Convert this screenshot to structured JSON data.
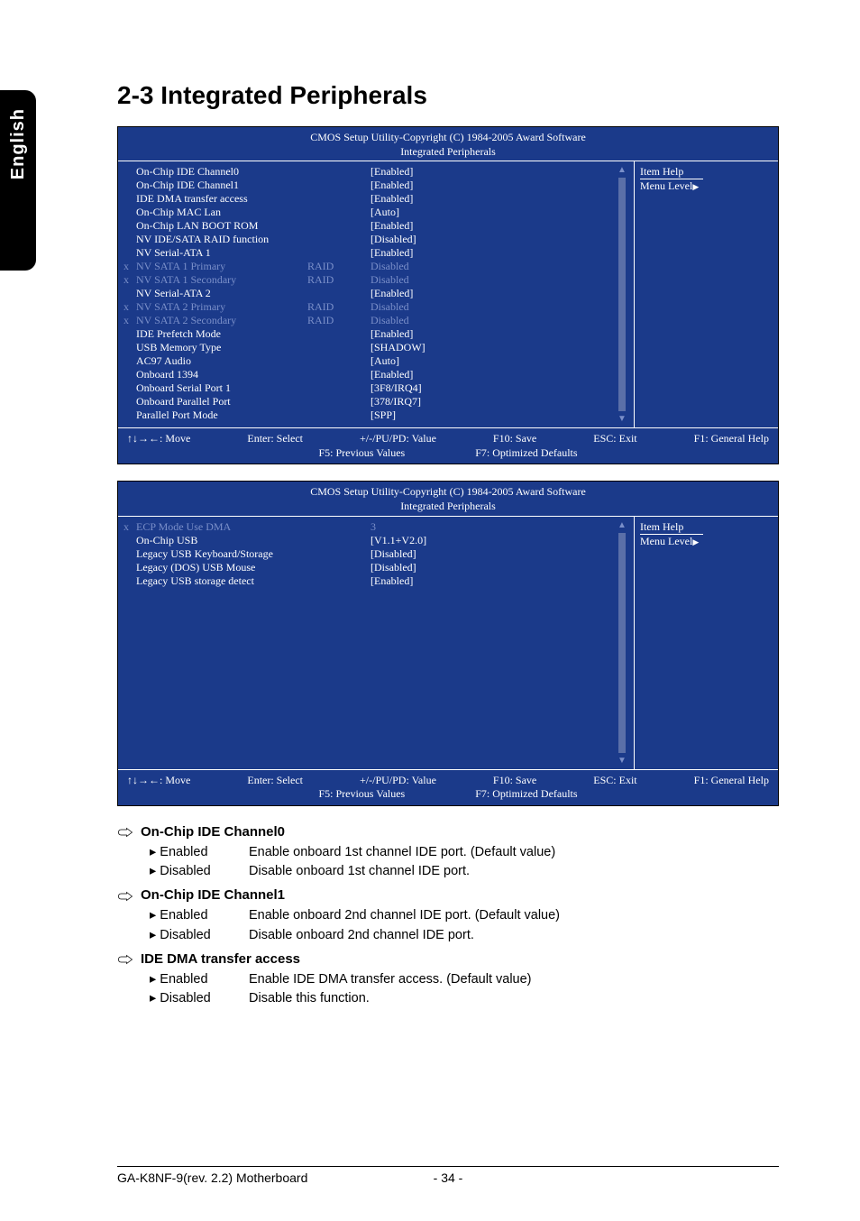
{
  "sideTab": "English",
  "title": "2-3    Integrated Peripherals",
  "biosHeader1": "CMOS Setup Utility-Copyright (C) 1984-2005 Award Software",
  "biosHeader2": "Integrated Peripherals",
  "helpTitle": "Item Help",
  "menuLevel": "Menu Level",
  "screen1": {
    "rows": [
      {
        "x": "",
        "label": "On-Chip IDE Channel0",
        "col3": "",
        "val": "[Enabled]",
        "dim": false
      },
      {
        "x": "",
        "label": "On-Chip IDE Channel1",
        "col3": "",
        "val": "[Enabled]",
        "dim": false
      },
      {
        "x": "",
        "label": "IDE DMA transfer access",
        "col3": "",
        "val": "[Enabled]",
        "dim": false
      },
      {
        "x": "",
        "label": "On-Chip MAC Lan",
        "col3": "",
        "val": "[Auto]",
        "dim": false
      },
      {
        "x": "",
        "label": "On-Chip LAN BOOT ROM",
        "col3": "",
        "val": "[Enabled]",
        "dim": false
      },
      {
        "x": "",
        "label": "NV IDE/SATA RAID function",
        "col3": "",
        "val": "[Disabled]",
        "dim": false
      },
      {
        "x": "",
        "label": "NV Serial-ATA 1",
        "col3": "",
        "val": "[Enabled]",
        "dim": false
      },
      {
        "x": "x",
        "label": "NV SATA 1 Primary",
        "col3": "RAID",
        "val": "Disabled",
        "dim": true
      },
      {
        "x": "x",
        "label": "NV SATA 1 Secondary",
        "col3": "RAID",
        "val": "Disabled",
        "dim": true
      },
      {
        "x": "",
        "label": "NV Serial-ATA 2",
        "col3": "",
        "val": "[Enabled]",
        "dim": false
      },
      {
        "x": "x",
        "label": "NV SATA 2 Primary",
        "col3": "RAID",
        "val": "Disabled",
        "dim": true
      },
      {
        "x": "x",
        "label": "NV SATA 2 Secondary",
        "col3": "RAID",
        "val": "Disabled",
        "dim": true
      },
      {
        "x": "",
        "label": "IDE Prefetch Mode",
        "col3": "",
        "val": "[Enabled]",
        "dim": false
      },
      {
        "x": "",
        "label": "USB Memory Type",
        "col3": "",
        "val": "[SHADOW]",
        "dim": false
      },
      {
        "x": "",
        "label": "AC97 Audio",
        "col3": "",
        "val": "[Auto]",
        "dim": false
      },
      {
        "x": "",
        "label": "Onboard 1394",
        "col3": "",
        "val": "[Enabled]",
        "dim": false
      },
      {
        "x": "",
        "label": "Onboard Serial Port 1",
        "col3": "",
        "val": "[3F8/IRQ4]",
        "dim": false
      },
      {
        "x": "",
        "label": "Onboard Parallel Port",
        "col3": "",
        "val": "[378/IRQ7]",
        "dim": false
      },
      {
        "x": "",
        "label": "Parallel Port Mode",
        "col3": "",
        "val": "[SPP]",
        "dim": false
      }
    ]
  },
  "screen2": {
    "rows": [
      {
        "x": "x",
        "label": "ECP Mode Use DMA",
        "col3": "",
        "val": "3",
        "dim": true
      },
      {
        "x": "",
        "label": "On-Chip USB",
        "col3": "",
        "val": "[V1.1+V2.0]",
        "dim": false
      },
      {
        "x": "",
        "label": "Legacy USB Keyboard/Storage",
        "col3": "",
        "val": "[Disabled]",
        "dim": false
      },
      {
        "x": "",
        "label": "Legacy (DOS) USB Mouse",
        "col3": "",
        "val": "[Disabled]",
        "dim": false
      },
      {
        "x": "",
        "label": "Legacy USB storage detect",
        "col3": "",
        "val": "[Enabled]",
        "dim": false
      }
    ]
  },
  "footKeys": {
    "move": "↑↓→←: Move",
    "enter": "Enter: Select",
    "value": "+/-/PU/PD: Value",
    "save": "F10: Save",
    "exit": "ESC: Exit",
    "help": "F1: General Help",
    "prev": "F5: Previous Values",
    "opt": "F7: Optimized Defaults"
  },
  "doc": {
    "sections": [
      {
        "title": "On-Chip IDE Channel0",
        "items": [
          {
            "opt": "Enabled",
            "desc": "Enable onboard 1st channel IDE port. (Default value)"
          },
          {
            "opt": "Disabled",
            "desc": "Disable onboard 1st channel IDE port."
          }
        ]
      },
      {
        "title": "On-Chip IDE Channel1",
        "items": [
          {
            "opt": "Enabled",
            "desc": "Enable onboard 2nd channel IDE port. (Default value)"
          },
          {
            "opt": "Disabled",
            "desc": "Disable onboard 2nd channel IDE port."
          }
        ]
      },
      {
        "title": "IDE DMA transfer access",
        "items": [
          {
            "opt": "Enabled",
            "desc": "Enable IDE DMA transfer access. (Default value)"
          },
          {
            "opt": "Disabled",
            "desc": "Disable this function."
          }
        ]
      }
    ]
  },
  "footer": {
    "left": "GA-K8NF-9(rev. 2.2) Motherboard",
    "center": "- 34 -"
  }
}
